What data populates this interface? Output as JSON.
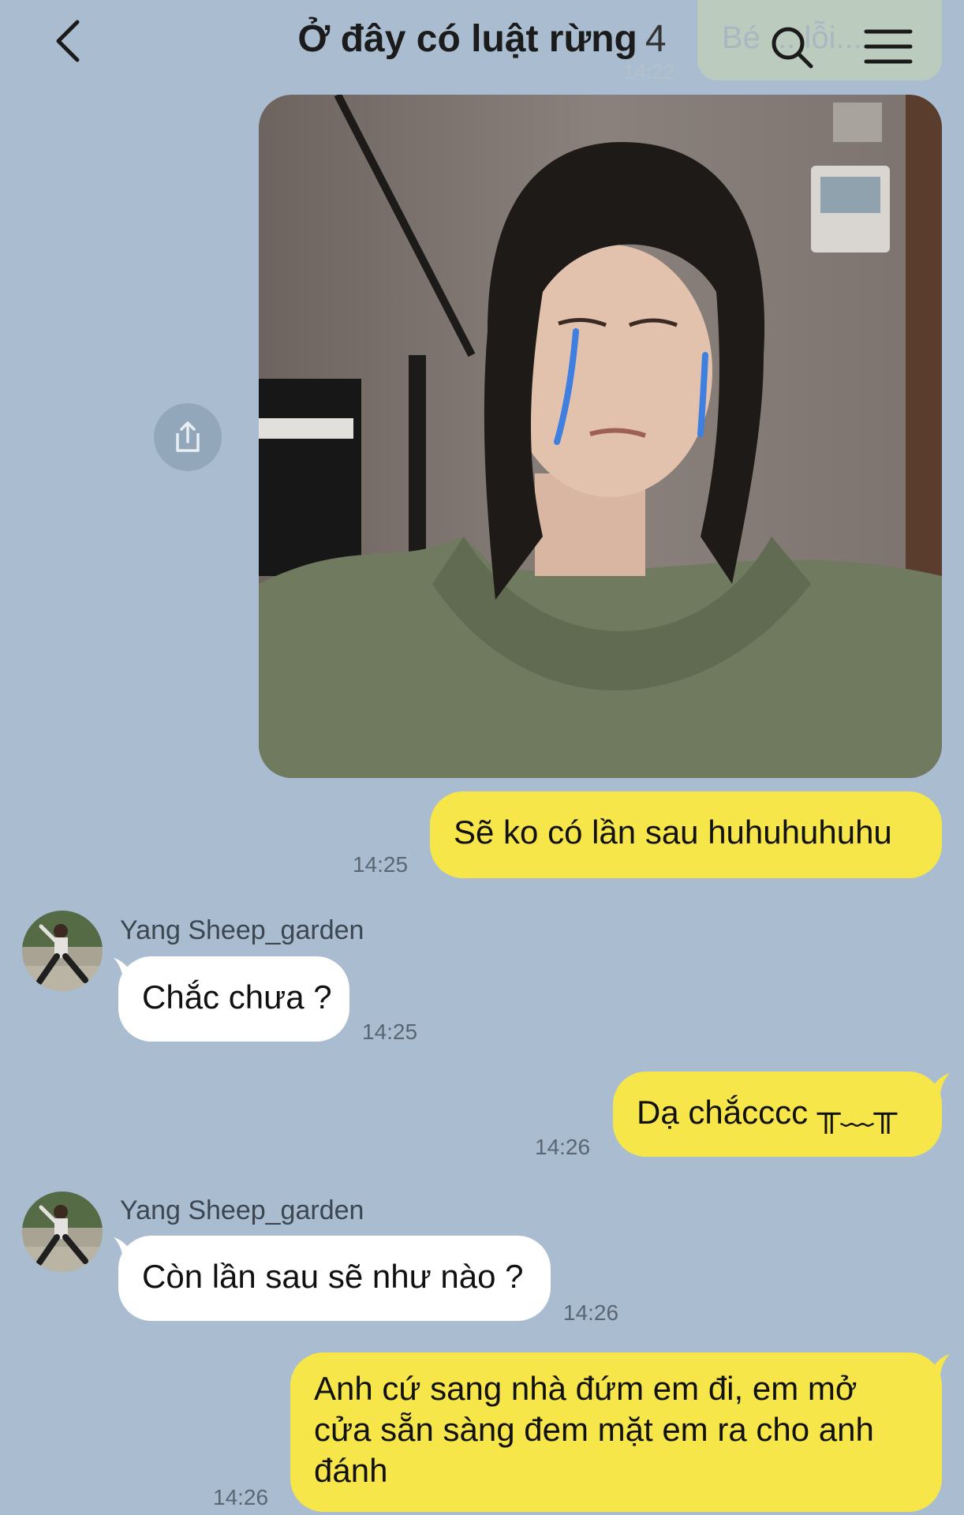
{
  "header": {
    "back_icon": "chevron-left-icon",
    "title": "Ở đây có luật rừng",
    "member_count": "4",
    "search_icon": "search-icon",
    "menu_icon": "menu-icon",
    "pinned_ghost_text": "Bé ... lỗi...",
    "pinned_ghost_time": "14:22"
  },
  "messages": {
    "photo": {
      "share_icon": "share-icon"
    },
    "m1": {
      "text": "Sẽ ko có lần sau huhuhuhuhu",
      "time": "14:25"
    },
    "m2": {
      "sender": "Yang Sheep_garden",
      "text": "Chắc chưa ?",
      "time": "14:25"
    },
    "m3": {
      "text": "Dạ chắcccc ╥﹏╥",
      "time": "14:26"
    },
    "m4": {
      "sender": "Yang Sheep_garden",
      "text": "Còn lần sau sẽ như nào ?",
      "time": "14:26"
    },
    "m5": {
      "text": "Anh cứ sang nhà đứm em đi, em mở cửa sẵn sàng đem mặt em ra cho anh đánh",
      "time": "14:26"
    }
  },
  "colors": {
    "background": "#aabdd0",
    "outgoing_bubble": "#f6e649",
    "incoming_bubble": "#ffffff"
  }
}
